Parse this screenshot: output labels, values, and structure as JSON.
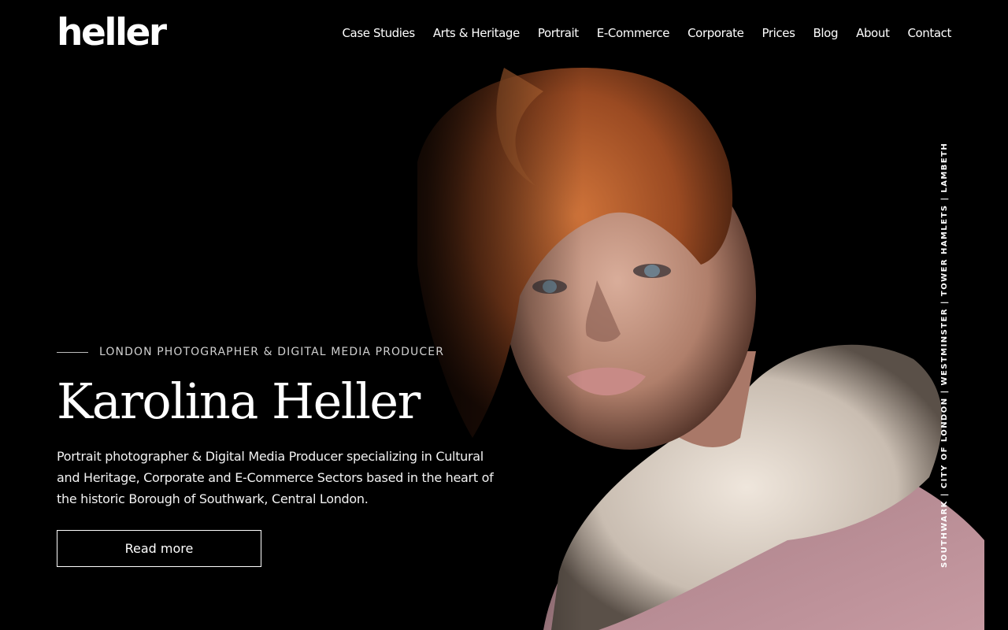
{
  "brand": {
    "logo_text": "heller"
  },
  "nav": {
    "items": [
      {
        "label": "Case Studies"
      },
      {
        "label": "Arts & Heritage"
      },
      {
        "label": "Portrait"
      },
      {
        "label": "E-Commerce"
      },
      {
        "label": "Corporate"
      },
      {
        "label": "Prices"
      },
      {
        "label": "Blog"
      },
      {
        "label": "About"
      },
      {
        "label": "Contact"
      }
    ]
  },
  "hero": {
    "eyebrow": "LONDON PHOTOGRAPHER & DIGITAL MEDIA PRODUCER",
    "title": "Karolina Heller",
    "description": "Portrait photographer & Digital Media Producer specializing in Cultural and Heritage, Corporate and E-Commerce Sectors based in the heart of the historic Borough of Southwark, Central London.",
    "button_label": "Read more",
    "image_alt_subject": "portrait-photo"
  },
  "areas": {
    "text": "SOUTHWARK | CITY OF LONDON | WESTMINSTER | TOWER HAMLETS | LAMBETH"
  },
  "colors": {
    "background": "#000000",
    "text": "#ffffff",
    "hair": "#b5582a",
    "skin": "#c89a86",
    "fur": "#e3d8cc",
    "coat": "#b0818a"
  }
}
